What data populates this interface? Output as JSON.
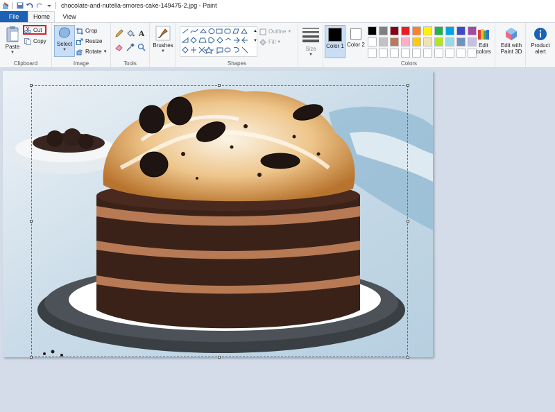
{
  "window": {
    "title": "chocolate-and-nutella-smores-cake-149475-2.jpg - Paint"
  },
  "tabs": {
    "file": "File",
    "home": "Home",
    "view": "View"
  },
  "clipboard": {
    "paste": "Paste",
    "cut": "Cut",
    "copy": "Copy",
    "label": "Clipboard"
  },
  "image_group": {
    "select": "Select",
    "crop": "Crop",
    "resize": "Resize",
    "rotate": "Rotate",
    "label": "Image"
  },
  "tools": {
    "label": "Tools",
    "brushes": "Brushes"
  },
  "shapes": {
    "outline": "Outline",
    "fill": "Fill",
    "label": "Shapes"
  },
  "size": {
    "label": "Size"
  },
  "colors": {
    "color1": "Color 1",
    "color2": "Color 2",
    "label": "Colors",
    "edit_colors": "Edit colors",
    "color1_value": "#000000",
    "color2_value": "#ffffff",
    "palette": [
      "#000000",
      "#7f7f7f",
      "#880015",
      "#ed1c24",
      "#ff7f27",
      "#fff200",
      "#22b14c",
      "#00a2e8",
      "#3f48cc",
      "#a349a4",
      "#ffffff",
      "#c3c3c3",
      "#b97a57",
      "#ffaec9",
      "#ffc90e",
      "#efe4b0",
      "#b5e61d",
      "#99d9ea",
      "#7092be",
      "#c8bfe7",
      "#ffffff",
      "#ffffff",
      "#ffffff",
      "#ffffff",
      "#ffffff",
      "#ffffff",
      "#ffffff",
      "#ffffff",
      "#ffffff",
      "#ffffff"
    ]
  },
  "extras": {
    "paint3d": "Edit with Paint 3D",
    "product_alert": "Product alert"
  }
}
